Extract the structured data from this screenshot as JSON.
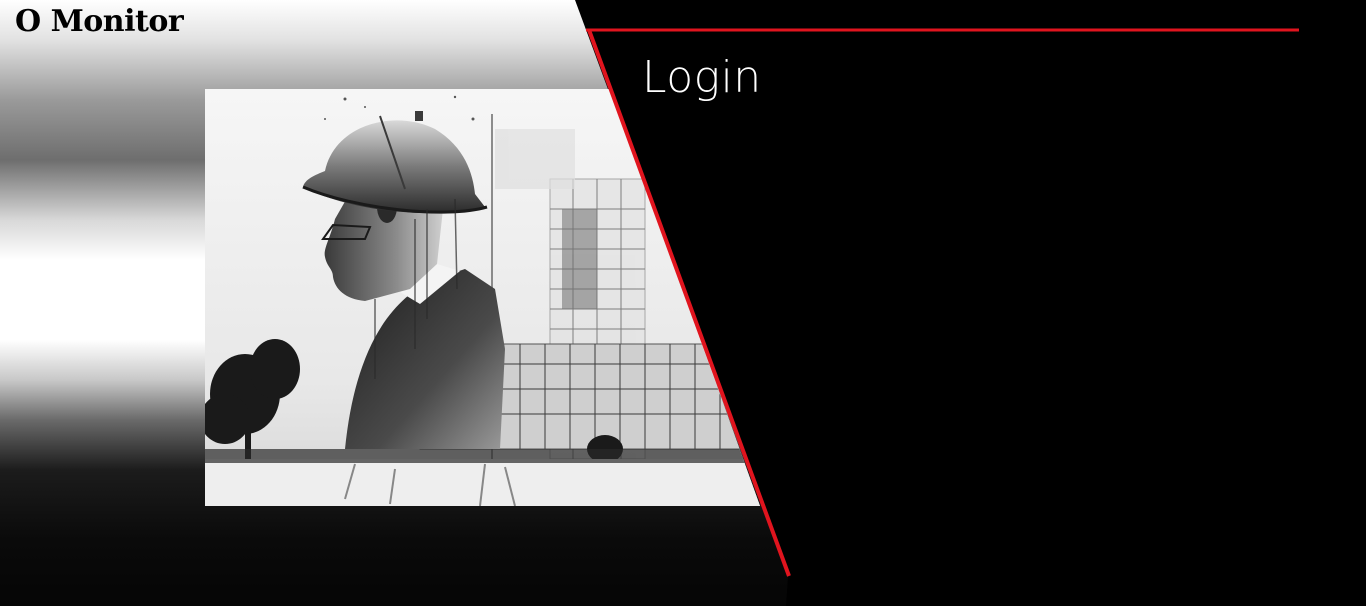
{
  "brand": {
    "title": "O Monitor"
  },
  "login": {
    "heading": "Login"
  },
  "hero": {
    "image_description_icon": "engineer-hardhat-building-illustration"
  },
  "colors": {
    "accent": "#e0141e",
    "background": "#000000",
    "heading_text": "#ffffff",
    "brand_text": "#000000"
  }
}
